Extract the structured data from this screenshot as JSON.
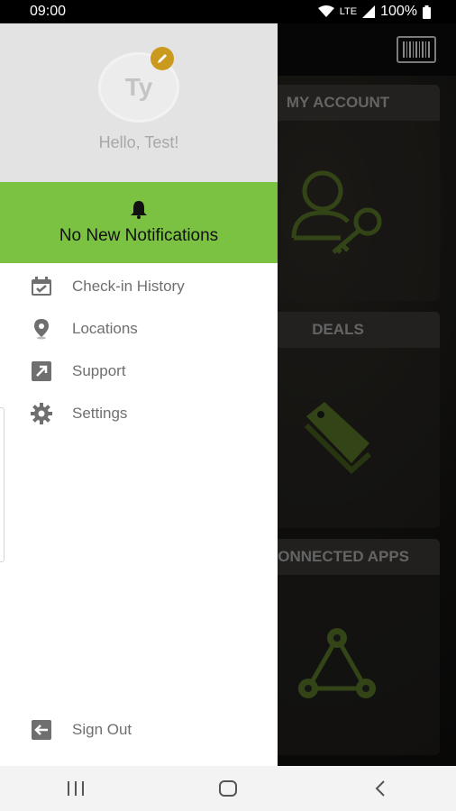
{
  "status_bar": {
    "time": "09:00",
    "network": "LTE",
    "battery": "100%"
  },
  "background_app": {
    "tiles": [
      {
        "title": "MY ACCOUNT",
        "icon": "account-key-icon"
      },
      {
        "title": "DEALS",
        "icon": "tag-icon"
      },
      {
        "title": "CONNECTED APPS",
        "icon": "network-icon"
      }
    ],
    "icon_color": "#4f6b24"
  },
  "drawer": {
    "avatar_initials": "Ty",
    "greeting": "Hello, Test!",
    "notifications": {
      "text": "No New Notifications",
      "background": "#7cc242"
    },
    "menu_items": [
      {
        "label": "Check-in History",
        "icon": "calendar-check-icon"
      },
      {
        "label": "Locations",
        "icon": "location-pin-icon"
      },
      {
        "label": "Support",
        "icon": "external-link-icon"
      },
      {
        "label": "Settings",
        "icon": "gear-icon"
      }
    ],
    "sign_out_label": "Sign Out"
  },
  "nav_bar": {
    "buttons": [
      "recents",
      "home",
      "back"
    ]
  }
}
